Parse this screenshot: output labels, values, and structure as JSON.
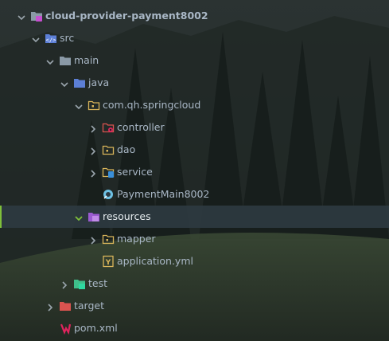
{
  "tree": [
    {
      "label": "cloud-provider-payment8002",
      "bold": true,
      "depth": 0,
      "expanded": true,
      "icon": "module-folder-icon",
      "name": "tree-item-cloud-provider-payment8002"
    },
    {
      "label": "src",
      "depth": 1,
      "expanded": true,
      "icon": "source-folder-icon",
      "name": "tree-item-src"
    },
    {
      "label": "main",
      "depth": 2,
      "expanded": true,
      "icon": "folder-icon",
      "name": "tree-item-main"
    },
    {
      "label": "java",
      "depth": 3,
      "expanded": true,
      "icon": "source-root-folder-icon",
      "name": "tree-item-java"
    },
    {
      "label": "com.qh.springcloud",
      "depth": 4,
      "expanded": true,
      "icon": "package-icon",
      "name": "tree-item-com-qh-springcloud"
    },
    {
      "label": "controller",
      "depth": 5,
      "expanded": false,
      "icon": "controller-package-icon",
      "name": "tree-item-controller"
    },
    {
      "label": "dao",
      "depth": 5,
      "expanded": false,
      "icon": "package-icon",
      "name": "tree-item-dao"
    },
    {
      "label": "service",
      "depth": 5,
      "expanded": false,
      "icon": "service-package-icon",
      "name": "tree-item-service"
    },
    {
      "label": "PaymentMain8002",
      "depth": 5,
      "leaf": true,
      "icon": "spring-boot-class-icon",
      "name": "tree-item-paymentmain8002"
    },
    {
      "label": "resources",
      "depth": 4,
      "expanded": true,
      "selected": true,
      "icon": "resources-folder-icon",
      "name": "tree-item-resources"
    },
    {
      "label": "mapper",
      "depth": 5,
      "expanded": false,
      "icon": "package-icon",
      "name": "tree-item-mapper"
    },
    {
      "label": "application.yml",
      "depth": 5,
      "leaf": true,
      "icon": "yaml-file-icon",
      "name": "tree-item-application-yml"
    },
    {
      "label": "test",
      "depth": 3,
      "expanded": false,
      "icon": "test-folder-icon",
      "name": "tree-item-test"
    },
    {
      "label": "target",
      "depth": 2,
      "expanded": false,
      "icon": "excluded-folder-icon",
      "name": "tree-item-target"
    },
    {
      "label": "pom.xml",
      "depth": 2,
      "leaf": true,
      "icon": "maven-file-icon",
      "name": "tree-item-pom-xml"
    }
  ],
  "colors": {
    "text": "#a9b7c6",
    "selected_text": "#e6ecef",
    "selection_bg": "#2e3a40",
    "selection_accent": "#7fbf3a",
    "folder": "#8a99a6",
    "package": "#d9b55a",
    "source": "#5c7fd6",
    "resources": "#9b5bd1",
    "test": "#3fbf8a",
    "excluded": "#d9534f",
    "maven": "#e0245e"
  }
}
